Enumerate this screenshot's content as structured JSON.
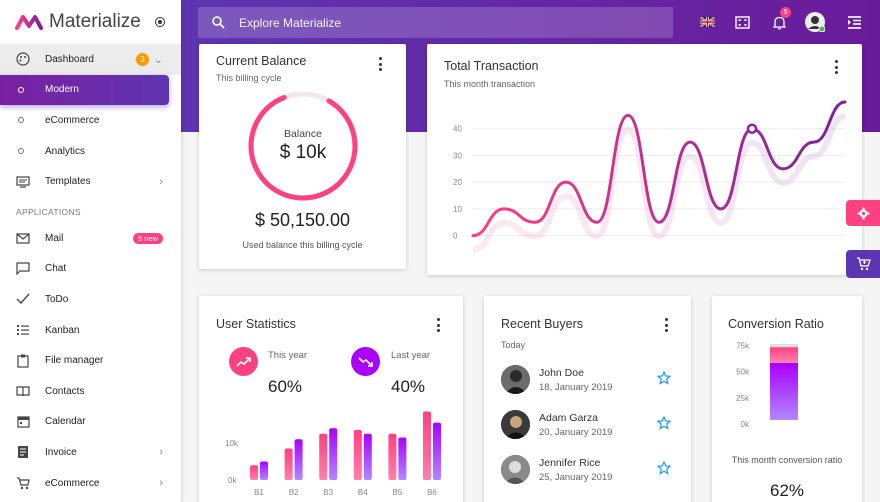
{
  "brand": {
    "name": "Materialize"
  },
  "sidebar": {
    "dashboard": {
      "label": "Dashboard",
      "count": "3"
    },
    "sub": [
      {
        "label": "Modern"
      },
      {
        "label": "eCommerce"
      },
      {
        "label": "Analytics"
      }
    ],
    "templates": {
      "label": "Templates"
    },
    "section_header": "APPLICATIONS",
    "apps": [
      {
        "label": "Mail",
        "badge": "5 new"
      },
      {
        "label": "Chat"
      },
      {
        "label": "ToDo"
      },
      {
        "label": "Kanban"
      },
      {
        "label": "File manager"
      },
      {
        "label": "Contacts"
      },
      {
        "label": "Calendar"
      },
      {
        "label": "Invoice"
      },
      {
        "label": "eCommerce"
      }
    ]
  },
  "header": {
    "search_placeholder": "Explore Materialize",
    "notifications": "5"
  },
  "balance": {
    "title": "Current Balance",
    "subtitle": "This billing cycle",
    "ring_label": "Balance",
    "ring_value": "$ 10k",
    "amount": "$ 50,150.00",
    "footnote": "Used balance this billing cycle"
  },
  "transaction": {
    "title": "Total Transaction",
    "subtitle": "This month transaction"
  },
  "user_stats": {
    "title": "User Statistics",
    "this_year_label": "This year",
    "this_year_value": "60%",
    "last_year_label": "Last year",
    "last_year_value": "40%"
  },
  "buyers": {
    "title": "Recent Buyers",
    "subtitle": "Today",
    "items": [
      {
        "name": "John Doe",
        "date": "18, January 2019"
      },
      {
        "name": "Adam Garza",
        "date": "20, January 2019"
      },
      {
        "name": "Jennifer Rice",
        "date": "25, January 2019"
      }
    ]
  },
  "conversion": {
    "title": "Conversion Ratio",
    "caption": "This month conversion ratio",
    "value": "62%"
  },
  "colors": {
    "primary": "#5e35b1",
    "accent": "#ff4081",
    "purple": "#6a1b9a",
    "orange": "#ff9800"
  },
  "chart_data": [
    {
      "type": "line",
      "x": [
        0,
        1,
        2,
        3,
        4,
        5,
        6,
        7,
        8,
        9,
        10,
        11,
        12
      ],
      "y": [
        0,
        10,
        5,
        20,
        5,
        45,
        5,
        35,
        10,
        40,
        25,
        35,
        50
      ],
      "yticks": [
        0,
        10,
        20,
        30,
        40
      ],
      "ylim": [
        -5,
        50
      ],
      "title": "Total Transaction",
      "grid": true
    },
    {
      "type": "bar",
      "categories": [
        "B1",
        "B2",
        "B3",
        "B4",
        "B5",
        "B6"
      ],
      "series": [
        {
          "values": [
            4,
            8.5,
            12.5,
            13.5,
            12.5,
            18.5
          ]
        },
        {
          "values": [
            5,
            11,
            14,
            12.5,
            11.5,
            15.5
          ]
        }
      ],
      "yticks": [
        "0k",
        "10k"
      ],
      "ylim": [
        0,
        20
      ],
      "title": "User Statistics"
    },
    {
      "type": "bar",
      "stacked": true,
      "categories": [
        ""
      ],
      "series": [
        {
          "values": [
            60
          ]
        },
        {
          "values": [
            15
          ]
        }
      ],
      "yticks": [
        "0k",
        "25k",
        "50k",
        "75k"
      ],
      "ylim": [
        0,
        80
      ],
      "title": "Conversion Ratio"
    }
  ]
}
